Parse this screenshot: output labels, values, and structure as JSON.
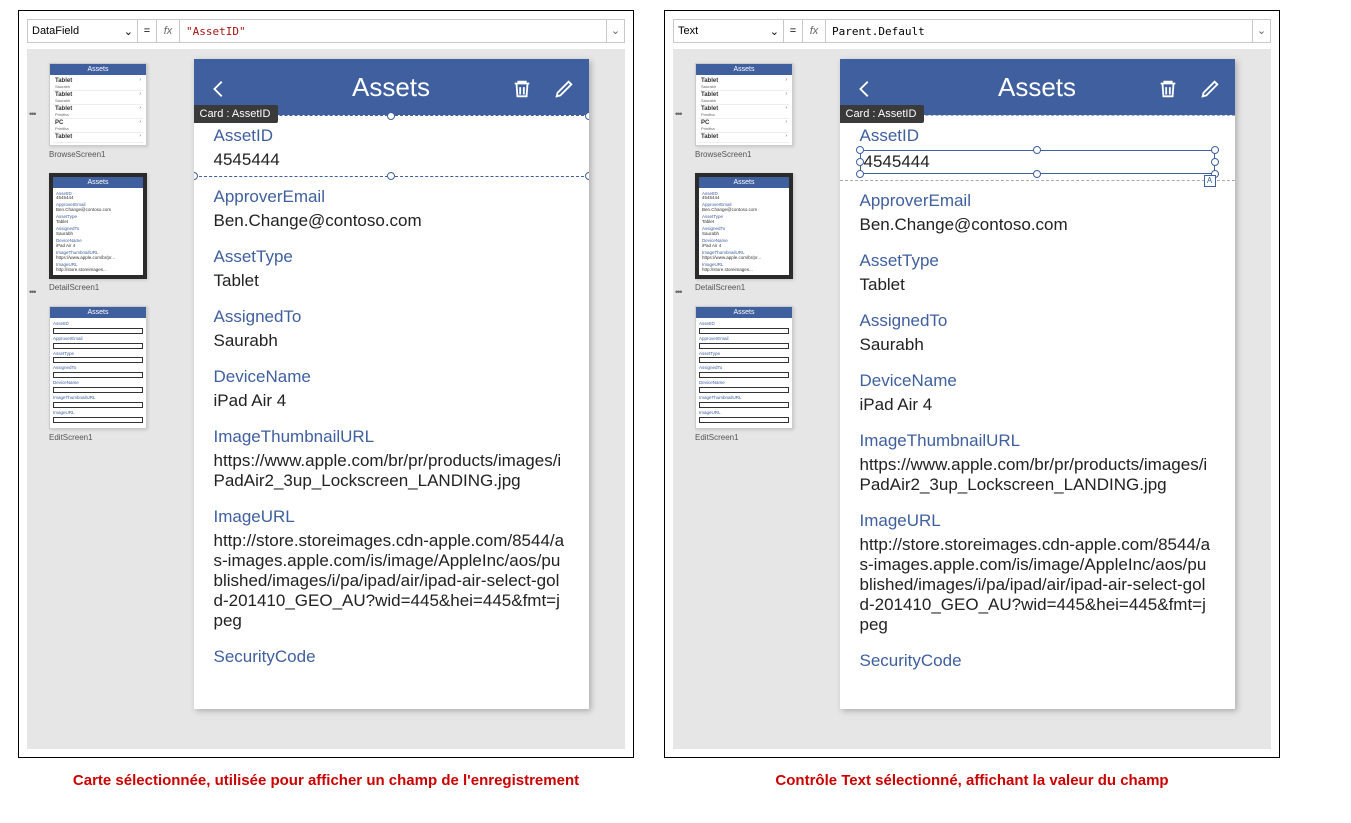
{
  "left": {
    "property": "DataField",
    "formula": "\"AssetID\"",
    "tag": "Card : AssetID",
    "caption": "Carte sélectionnée, utilisée pour afficher un champ de l'enregistrement"
  },
  "right": {
    "property": "Text",
    "formula": "Parent.Default",
    "tag": "Card : AssetID",
    "caption": "Contrôle Text sélectionné, affichant la valeur du champ"
  },
  "thumbs": {
    "browse": "BrowseScreen1",
    "detail": "DetailScreen1",
    "edit": "EditScreen1",
    "assets_title": "Assets"
  },
  "phone": {
    "title": "Assets",
    "fields": [
      {
        "label": "AssetID",
        "value": "4545444"
      },
      {
        "label": "ApproverEmail",
        "value": "Ben.Change@contoso.com"
      },
      {
        "label": "AssetType",
        "value": "Tablet"
      },
      {
        "label": "AssignedTo",
        "value": "Saurabh"
      },
      {
        "label": "DeviceName",
        "value": "iPad Air 4"
      },
      {
        "label": "ImageThumbnailURL",
        "value": "https://www.apple.com/br/pr/products/images/iPadAir2_3up_Lockscreen_LANDING.jpg"
      },
      {
        "label": "ImageURL",
        "value": "http://store.storeimages.cdn-apple.com/8544/as-images.apple.com/is/image/AppleInc/aos/published/images/i/pa/ipad/air/ipad-air-select-gold-201410_GEO_AU?wid=445&hei=445&fmt=jpeg"
      },
      {
        "label": "SecurityCode",
        "value": ""
      }
    ]
  },
  "thumb_list": {
    "items": [
      {
        "n": "Tablet",
        "s": "Saurabh"
      },
      {
        "n": "Tablet",
        "s": "Saurabh"
      },
      {
        "n": "Tablet",
        "s": "Prinitha"
      },
      {
        "n": "PC",
        "s": "Prinitha"
      },
      {
        "n": "Tablet",
        "s": ""
      }
    ],
    "detail_labels": [
      "AssetID",
      "ApproverEmail",
      "AssetType",
      "AssignedTo",
      "DeviceName",
      "ImageThumbnailURL",
      "ImageURL"
    ],
    "edit_labels": [
      "AssetID",
      "ApproverEmail",
      "AssetType",
      "AssignedTo",
      "DeviceName",
      "ImageThumbnailURL",
      "ImageURL"
    ]
  }
}
